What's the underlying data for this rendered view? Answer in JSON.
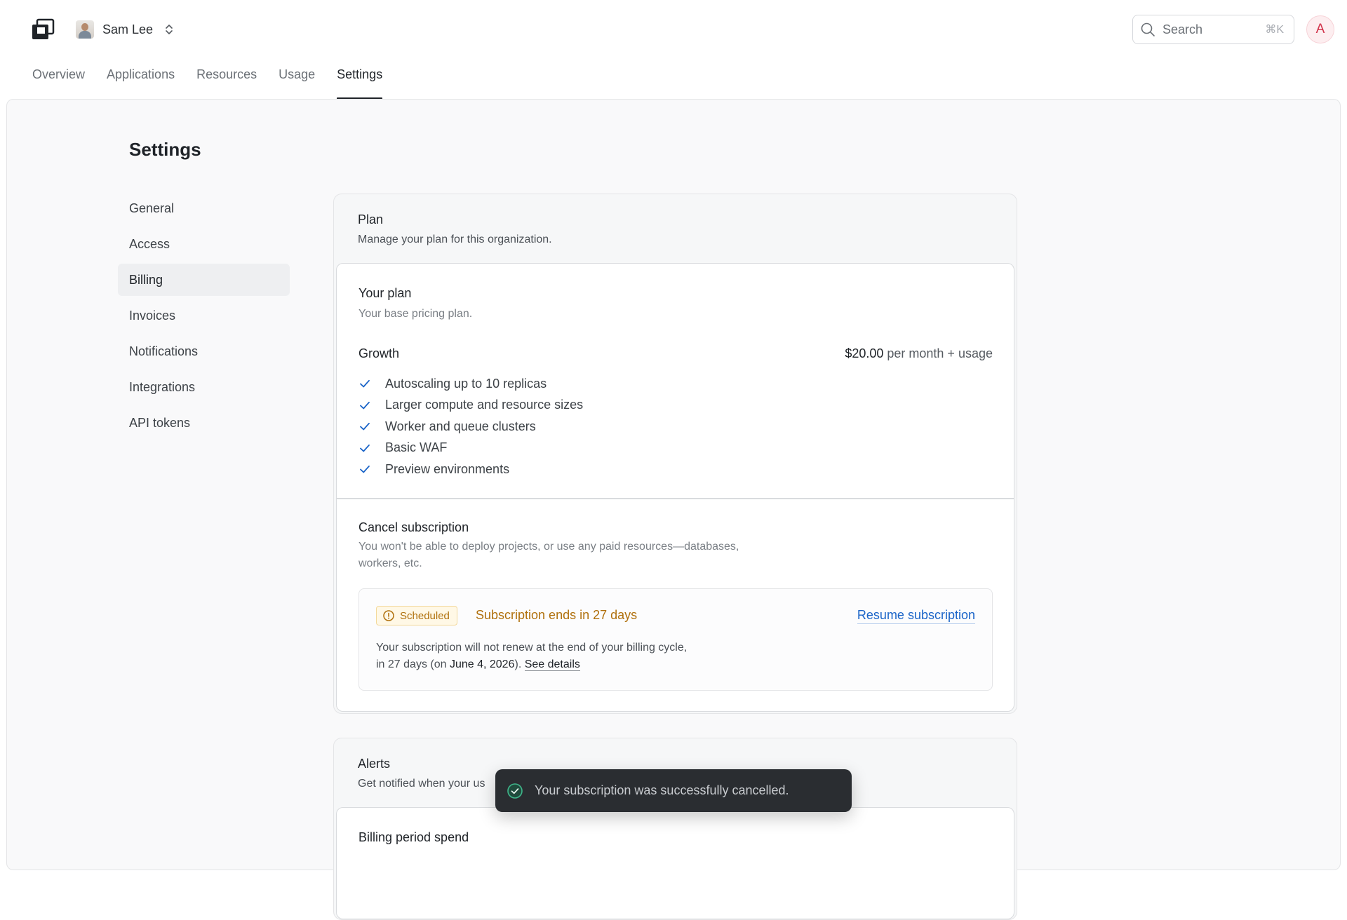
{
  "header": {
    "org_name": "Sam Lee",
    "search_placeholder": "Search",
    "search_shortcut": "⌘K",
    "user_initial": "A"
  },
  "tabs": [
    {
      "label": "Overview",
      "active": false
    },
    {
      "label": "Applications",
      "active": false
    },
    {
      "label": "Resources",
      "active": false
    },
    {
      "label": "Usage",
      "active": false
    },
    {
      "label": "Settings",
      "active": true
    }
  ],
  "page": {
    "title": "Settings"
  },
  "sidebar": {
    "items": [
      {
        "label": "General",
        "active": false
      },
      {
        "label": "Access",
        "active": false
      },
      {
        "label": "Billing",
        "active": true
      },
      {
        "label": "Invoices",
        "active": false
      },
      {
        "label": "Notifications",
        "active": false
      },
      {
        "label": "Integrations",
        "active": false
      },
      {
        "label": "API tokens",
        "active": false
      }
    ]
  },
  "plan_card": {
    "title": "Plan",
    "subtitle": "Manage your plan for this organization.",
    "your_plan": {
      "title": "Your plan",
      "subtitle": "Your base pricing plan.",
      "plan_name": "Growth",
      "price_amount": "$20.00",
      "price_suffix": " per month + usage",
      "features": [
        "Autoscaling up to 10 replicas",
        "Larger compute and resource sizes",
        "Worker and queue clusters",
        "Basic WAF",
        "Preview environments"
      ]
    },
    "cancel": {
      "title": "Cancel subscription",
      "subtitle_line1": "You won't be able to deploy projects, or use any paid resources—databases,",
      "subtitle_line2": "workers, etc.",
      "badge": "Scheduled",
      "status": "Subscription ends in 27 days",
      "resume_label": "Resume subscription",
      "body_line1": "Your subscription will not renew at the end of your billing cycle,",
      "body_line2_prefix": "in 27 days (on ",
      "body_date": "June 4, 2026",
      "body_line2_suffix": "). ",
      "details_label": "See details"
    }
  },
  "alerts_card": {
    "title": "Alerts",
    "subtitle": "Get notified when your us",
    "section_title": "Billing period spend"
  },
  "toast": {
    "message": "Your subscription was successfully cancelled."
  },
  "colors": {
    "accent_link": "#1a64c8",
    "warning": "#b0700c",
    "check": "#1a64c8",
    "toast_bg": "#2a2d31",
    "success": "#3fb68b"
  }
}
